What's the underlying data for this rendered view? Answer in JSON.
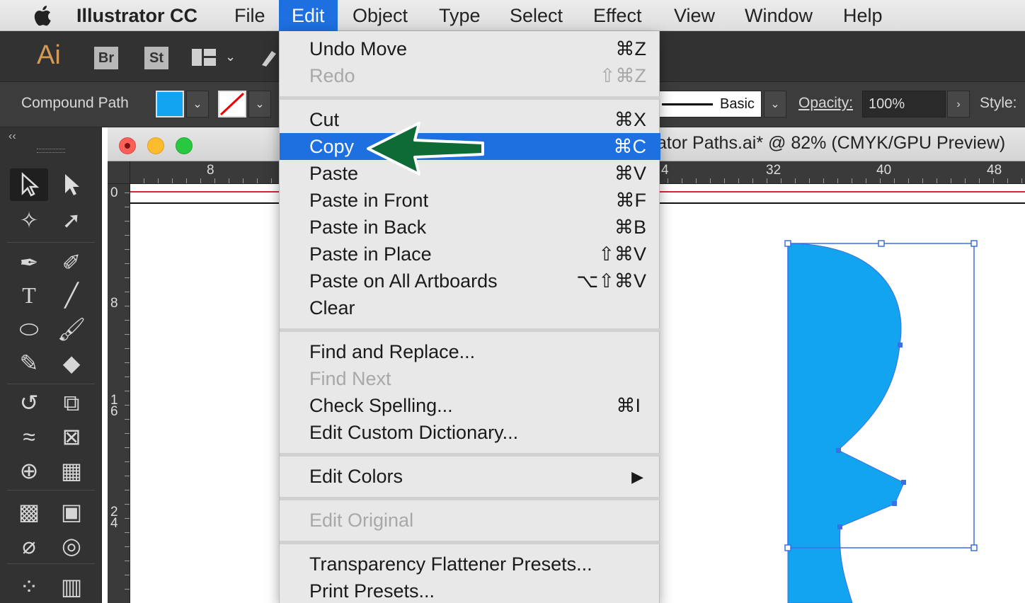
{
  "menubar": {
    "apple_icon": "apple-icon",
    "app_name": "Illustrator CC",
    "items": [
      "File",
      "Edit",
      "Object",
      "Type",
      "Select",
      "Effect",
      "View",
      "Window",
      "Help"
    ],
    "active": "Edit"
  },
  "appbar": {
    "logo": "Ai",
    "bridge": "Br",
    "stock": "St"
  },
  "controlbar": {
    "selection_label": "Compound Path",
    "fill_color": "#12a4ef",
    "stroke": "none",
    "stroke_profile": "Basic",
    "opacity_label": "Opacity:",
    "opacity_value": "100%",
    "style_label": "Style:"
  },
  "document": {
    "title": "ator Paths.ai* @ 82% (CMYK/GPU Preview)",
    "hruler_ticks": [
      "8",
      "4",
      "32",
      "40",
      "48"
    ],
    "vruler_ticks": [
      "0",
      "8",
      "1\n6",
      "2\n4"
    ]
  },
  "edit_menu": {
    "groups": [
      [
        {
          "label": "Undo Move",
          "shortcut": "⌘Z",
          "enabled": true
        },
        {
          "label": "Redo",
          "shortcut": "⇧⌘Z",
          "enabled": false
        }
      ],
      [
        {
          "label": "Cut",
          "shortcut": "⌘X",
          "enabled": true
        },
        {
          "label": "Copy",
          "shortcut": "⌘C",
          "enabled": true,
          "highlighted": true
        },
        {
          "label": "Paste",
          "shortcut": "⌘V",
          "enabled": true
        },
        {
          "label": "Paste in Front",
          "shortcut": "⌘F",
          "enabled": true
        },
        {
          "label": "Paste in Back",
          "shortcut": "⌘B",
          "enabled": true
        },
        {
          "label": "Paste in Place",
          "shortcut": "⇧⌘V",
          "enabled": true
        },
        {
          "label": "Paste on All Artboards",
          "shortcut": "⌥⇧⌘V",
          "enabled": true
        },
        {
          "label": "Clear",
          "shortcut": "",
          "enabled": true
        }
      ],
      [
        {
          "label": "Find and Replace...",
          "shortcut": "",
          "enabled": true
        },
        {
          "label": "Find Next",
          "shortcut": "",
          "enabled": false
        },
        {
          "label": "Check Spelling...",
          "shortcut": "⌘I",
          "enabled": true
        },
        {
          "label": "Edit Custom Dictionary...",
          "shortcut": "",
          "enabled": true
        }
      ],
      [
        {
          "label": "Edit Colors",
          "shortcut": "▶",
          "enabled": true
        }
      ],
      [
        {
          "label": "Edit Original",
          "shortcut": "",
          "enabled": false
        }
      ],
      [
        {
          "label": "Transparency Flattener Presets...",
          "shortcut": "",
          "enabled": true
        },
        {
          "label": "Print Presets...",
          "shortcut": "",
          "enabled": true
        }
      ]
    ]
  },
  "annotation": {
    "arrow_color": "#0e6b36",
    "points_to": "Copy"
  },
  "shape": {
    "fill": "#12a4ef",
    "selection_color": "#3b6fe6"
  }
}
